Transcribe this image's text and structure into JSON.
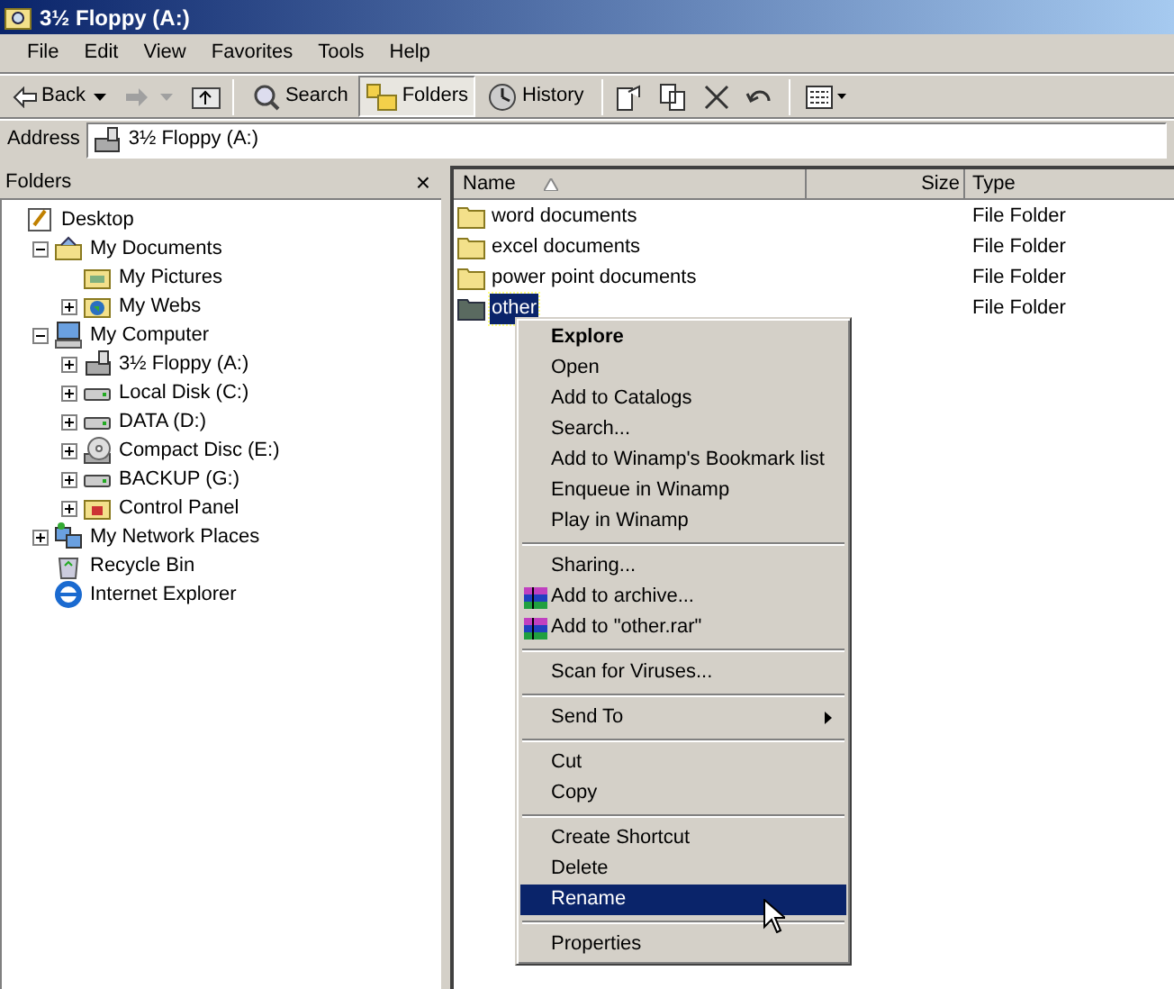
{
  "window": {
    "title": "3½ Floppy (A:)"
  },
  "menu_bar": [
    "File",
    "Edit",
    "View",
    "Favorites",
    "Tools",
    "Help"
  ],
  "toolbar": {
    "back": "Back",
    "buttons": [
      {
        "label": "Search",
        "selected": false
      },
      {
        "label": "Folders",
        "selected": true
      },
      {
        "label": "History",
        "selected": false
      }
    ]
  },
  "address": {
    "label": "Address",
    "value": "3½ Floppy (A:)"
  },
  "folders_pane": {
    "title": "Folders",
    "close": "×",
    "tree": [
      {
        "label": "Desktop",
        "kind": "desktop",
        "children": [
          {
            "label": "My Documents",
            "kind": "documents",
            "expanded": true,
            "children": [
              {
                "label": "My Pictures",
                "kind": "pictures"
              },
              {
                "label": "My Webs",
                "kind": "web",
                "expanded": false
              }
            ]
          },
          {
            "label": "My Computer",
            "kind": "computer",
            "expanded": true,
            "children": [
              {
                "label": "3½ Floppy (A:)",
                "kind": "floppy",
                "expanded": false
              },
              {
                "label": "Local Disk (C:)",
                "kind": "disk",
                "expanded": false
              },
              {
                "label": "DATA (D:)",
                "kind": "disk",
                "expanded": false
              },
              {
                "label": "Compact Disc (E:)",
                "kind": "cd",
                "expanded": false
              },
              {
                "label": "BACKUP (G:)",
                "kind": "disk",
                "expanded": false
              },
              {
                "label": "Control Panel",
                "kind": "control-panel",
                "expanded": false
              }
            ]
          },
          {
            "label": "My Network Places",
            "kind": "network",
            "expanded": false
          },
          {
            "label": "Recycle Bin",
            "kind": "recycle"
          },
          {
            "label": "Internet Explorer",
            "kind": "browser"
          }
        ]
      }
    ]
  },
  "file_list": {
    "columns": [
      "Name",
      "Size",
      "Type"
    ],
    "rows": [
      {
        "name": "word documents",
        "type": "File Folder",
        "selected": false
      },
      {
        "name": "excel documents",
        "type": "File Folder",
        "selected": false
      },
      {
        "name": "power point documents",
        "type": "File Folder",
        "selected": false
      },
      {
        "name": "other",
        "type": "File Folder",
        "selected": true
      }
    ]
  },
  "context_menu": [
    {
      "kind": "item",
      "label": "Explore",
      "default": true,
      "selected": false
    },
    {
      "kind": "item",
      "label": "Open",
      "selected": false
    },
    {
      "kind": "item",
      "label": "Add to Catalogs",
      "selected": false
    },
    {
      "kind": "item",
      "label": "Search...",
      "selected": false
    },
    {
      "kind": "item",
      "label": "Add to Winamp's Bookmark list",
      "selected": false
    },
    {
      "kind": "item",
      "label": "Enqueue in Winamp",
      "selected": false
    },
    {
      "kind": "item",
      "label": "Play in Winamp",
      "selected": false
    },
    {
      "kind": "separator"
    },
    {
      "kind": "item",
      "label": "Sharing...",
      "selected": false
    },
    {
      "kind": "archive",
      "label": "Add to archive...",
      "selected": false
    },
    {
      "kind": "archive",
      "label": "Add to \"other.rar\"",
      "selected": false
    },
    {
      "kind": "separator"
    },
    {
      "kind": "item",
      "label": "Scan for Viruses...",
      "selected": false
    },
    {
      "kind": "separator"
    },
    {
      "kind": "item",
      "label": "Send To",
      "submenu": true,
      "selected": false
    },
    {
      "kind": "separator"
    },
    {
      "kind": "item",
      "label": "Cut",
      "selected": false
    },
    {
      "kind": "item",
      "label": "Copy",
      "selected": false
    },
    {
      "kind": "separator"
    },
    {
      "kind": "item",
      "label": "Create Shortcut",
      "selected": false
    },
    {
      "kind": "item",
      "label": "Delete",
      "selected": false
    },
    {
      "kind": "item",
      "label": "Rename",
      "selected": true
    },
    {
      "kind": "separator"
    },
    {
      "kind": "item",
      "label": "Properties",
      "selected": false
    }
  ]
}
